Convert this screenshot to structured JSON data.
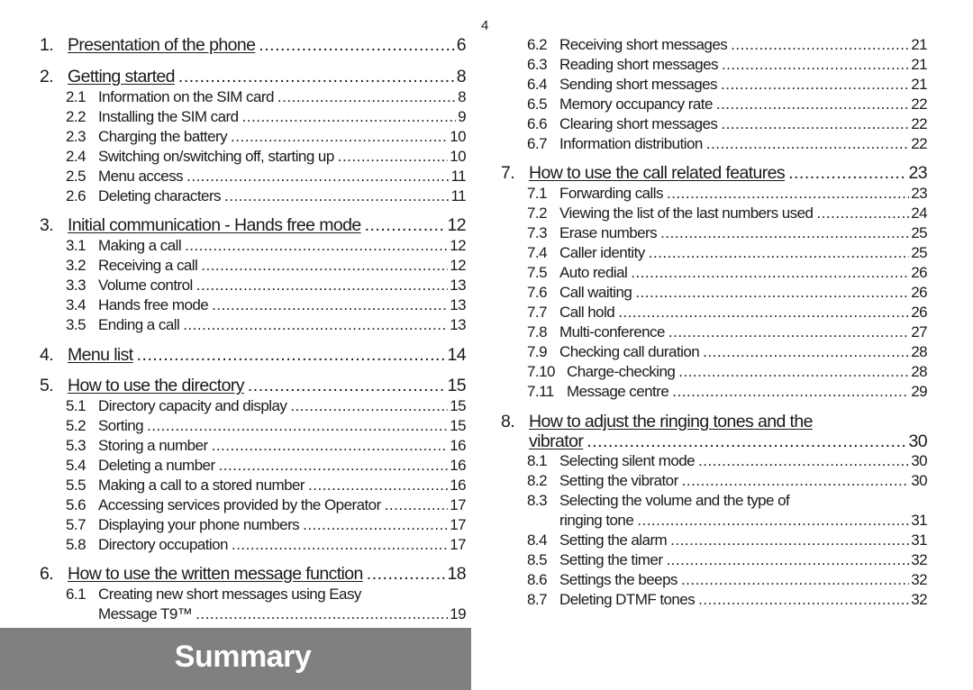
{
  "page_number": "4",
  "banner_title": "Summary",
  "left_column": [
    {
      "type": "chapter",
      "num": "1.",
      "title": "Presentation of the phone",
      "page": "6"
    },
    {
      "type": "chapter",
      "num": "2.",
      "title": "Getting started",
      "page": "8"
    },
    {
      "type": "section",
      "num": "2.1",
      "title": "Information on the SIM card",
      "page": "8"
    },
    {
      "type": "section",
      "num": "2.2",
      "title": "Installing the SIM card",
      "page": "9"
    },
    {
      "type": "section",
      "num": "2.3",
      "title": "Charging the battery",
      "page": "10"
    },
    {
      "type": "section",
      "num": "2.4",
      "title": "Switching on/switching off, starting up",
      "page": "10"
    },
    {
      "type": "section",
      "num": "2.5",
      "title": "Menu access",
      "page": "11"
    },
    {
      "type": "section",
      "num": "2.6",
      "title": "Deleting characters",
      "page": "11"
    },
    {
      "type": "chapter",
      "num": "3.",
      "title": "Initial communication - Hands free mode",
      "page": "12"
    },
    {
      "type": "section",
      "num": "3.1",
      "title": "Making a call",
      "page": "12"
    },
    {
      "type": "section",
      "num": "3.2",
      "title": "Receiving a call",
      "page": "12"
    },
    {
      "type": "section",
      "num": "3.3",
      "title": "Volume control",
      "page": "13"
    },
    {
      "type": "section",
      "num": "3.4",
      "title": "Hands free mode",
      "page": "13"
    },
    {
      "type": "section",
      "num": "3.5",
      "title": "Ending a call",
      "page": "13"
    },
    {
      "type": "chapter",
      "num": "4.",
      "title": "Menu list",
      "page": "14"
    },
    {
      "type": "chapter",
      "num": "5.",
      "title": "How to use the directory",
      "page": "15"
    },
    {
      "type": "section",
      "num": "5.1",
      "title": "Directory capacity and display",
      "page": "15"
    },
    {
      "type": "section",
      "num": "5.2",
      "title": "Sorting",
      "page": "15"
    },
    {
      "type": "section",
      "num": "5.3",
      "title": "Storing a number",
      "page": "16"
    },
    {
      "type": "section",
      "num": "5.4",
      "title": "Deleting a number",
      "page": "16"
    },
    {
      "type": "section",
      "num": "5.5",
      "title": "Making a call to a stored number",
      "page": "16"
    },
    {
      "type": "section",
      "num": "5.6",
      "title": "Accessing services provided by the Operator",
      "page": "17"
    },
    {
      "type": "section",
      "num": "5.7",
      "title": "Displaying your phone numbers",
      "page": "17"
    },
    {
      "type": "section",
      "num": "5.8",
      "title": "Directory occupation",
      "page": "17"
    },
    {
      "type": "chapter",
      "num": "6.",
      "title": "How to use the written message function",
      "page": "18"
    },
    {
      "type": "section-multi",
      "num": "6.1",
      "title": "Creating new short messages using Easy",
      "title_cont": "Message T9™",
      "page": "19"
    }
  ],
  "right_column": [
    {
      "type": "section",
      "num": "6.2",
      "title": "Receiving short messages",
      "page": "21"
    },
    {
      "type": "section",
      "num": "6.3",
      "title": "Reading short messages",
      "page": "21"
    },
    {
      "type": "section",
      "num": "6.4",
      "title": "Sending short messages",
      "page": "21"
    },
    {
      "type": "section",
      "num": "6.5",
      "title": "Memory occupancy rate",
      "page": "22"
    },
    {
      "type": "section",
      "num": "6.6",
      "title": "Clearing short messages",
      "page": "22"
    },
    {
      "type": "section",
      "num": "6.7",
      "title": "Information distribution",
      "page": "22"
    },
    {
      "type": "chapter",
      "num": "7.",
      "title": "How to use the call related features",
      "page": "23"
    },
    {
      "type": "section",
      "num": "7.1",
      "title": "Forwarding calls",
      "page": "23"
    },
    {
      "type": "section",
      "num": "7.2",
      "title": "Viewing the list of the last numbers used",
      "page": "24"
    },
    {
      "type": "section",
      "num": "7.3",
      "title": "Erase numbers",
      "page": "25"
    },
    {
      "type": "section",
      "num": "7.4",
      "title": "Caller identity",
      "page": "25"
    },
    {
      "type": "section",
      "num": "7.5",
      "title": "Auto redial",
      "page": "26"
    },
    {
      "type": "section",
      "num": "7.6",
      "title": "Call waiting",
      "page": "26"
    },
    {
      "type": "section",
      "num": "7.7",
      "title": "Call hold",
      "page": "26"
    },
    {
      "type": "section",
      "num": "7.8",
      "title": "Multi-conference",
      "page": "27"
    },
    {
      "type": "section",
      "num": "7.9",
      "title": "Checking call duration",
      "page": "28"
    },
    {
      "type": "section",
      "num": "7.10",
      "title": "Charge-checking",
      "page": "28"
    },
    {
      "type": "section",
      "num": "7.11",
      "title": "Message centre",
      "page": "29"
    },
    {
      "type": "chapter-multi",
      "num": "8.",
      "title": "How to adjust the ringing tones and the",
      "title_cont": "vibrator",
      "page": "30"
    },
    {
      "type": "section",
      "num": "8.1",
      "title": "Selecting silent mode",
      "page": "30"
    },
    {
      "type": "section",
      "num": "8.2",
      "title": "Setting the vibrator",
      "page": "30"
    },
    {
      "type": "section-multi",
      "num": "8.3",
      "title": "Selecting the volume and the type of",
      "title_cont": "ringing tone",
      "page": "31"
    },
    {
      "type": "section",
      "num": "8.4",
      "title": "Setting the alarm",
      "page": "31"
    },
    {
      "type": "section",
      "num": "8.5",
      "title": "Setting the timer",
      "page": "32"
    },
    {
      "type": "section",
      "num": "8.6",
      "title": "Settings the beeps",
      "page": "32"
    },
    {
      "type": "section",
      "num": "8.7",
      "title": "Deleting DTMF tones",
      "page": "32"
    }
  ]
}
